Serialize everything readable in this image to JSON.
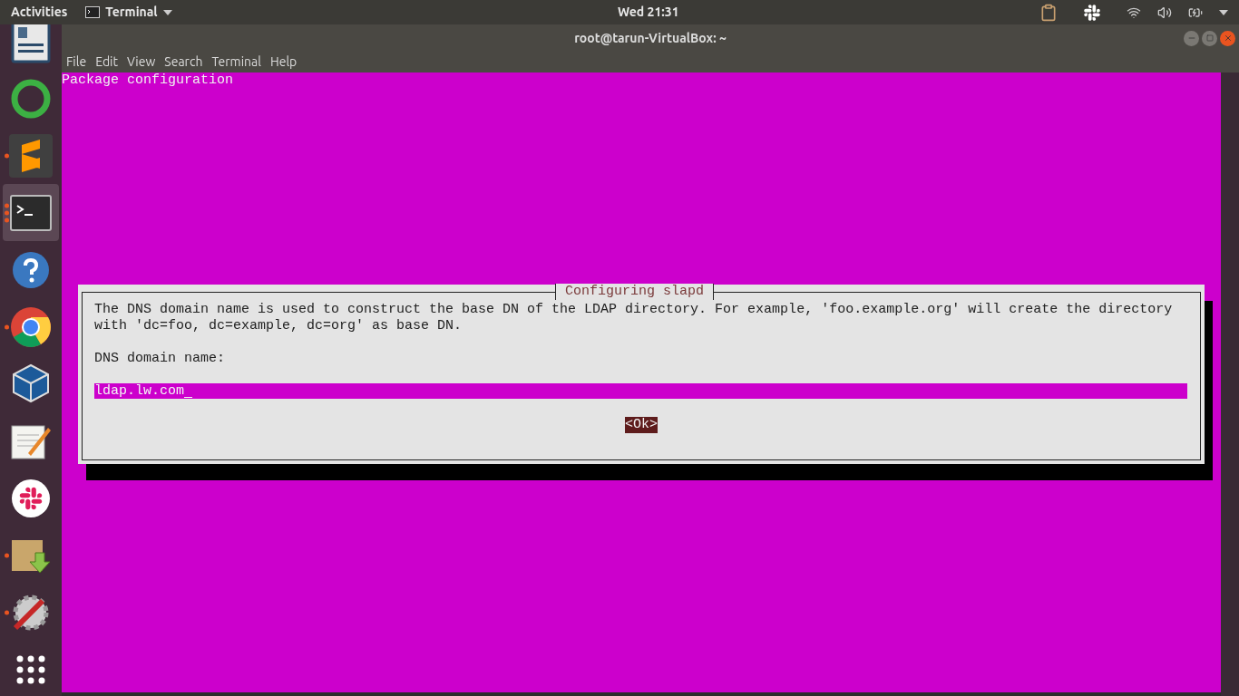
{
  "top_bar": {
    "activities": "Activities",
    "app_menu": "Terminal",
    "clock": "Wed 21:31"
  },
  "dock": [
    {
      "kind": "document-viewer",
      "running": false,
      "selected": false
    },
    {
      "kind": "ring",
      "running": false,
      "selected": false
    },
    {
      "kind": "sublime",
      "running": true,
      "selected": false
    },
    {
      "kind": "terminal",
      "running": true,
      "selected": true
    },
    {
      "kind": "help",
      "running": false,
      "selected": false
    },
    {
      "kind": "chrome",
      "running": true,
      "selected": false
    },
    {
      "kind": "virtualbox",
      "running": false,
      "selected": false
    },
    {
      "kind": "text-editor",
      "running": false,
      "selected": false
    },
    {
      "kind": "slack",
      "running": false,
      "selected": false
    },
    {
      "kind": "package",
      "running": true,
      "selected": false
    },
    {
      "kind": "tools",
      "running": true,
      "selected": false
    },
    {
      "kind": "app-grid",
      "running": false,
      "selected": false
    }
  ],
  "window": {
    "title": "root@tarun-VirtualBox: ~",
    "menu": [
      "File",
      "Edit",
      "View",
      "Search",
      "Terminal",
      "Help"
    ]
  },
  "terminal": {
    "header": "Package configuration",
    "dialog": {
      "title": "Configuring slapd",
      "description": [
        "The DNS domain name is used to construct the base DN of the LDAP directory. For example, 'foo.example.org' will create the directory",
        "with 'dc=foo, dc=example, dc=org' as base DN."
      ],
      "label": "DNS domain name:",
      "value": "ldap.lw.com",
      "buttons": [
        {
          "label": "<Ok>",
          "selected": true
        }
      ]
    }
  }
}
